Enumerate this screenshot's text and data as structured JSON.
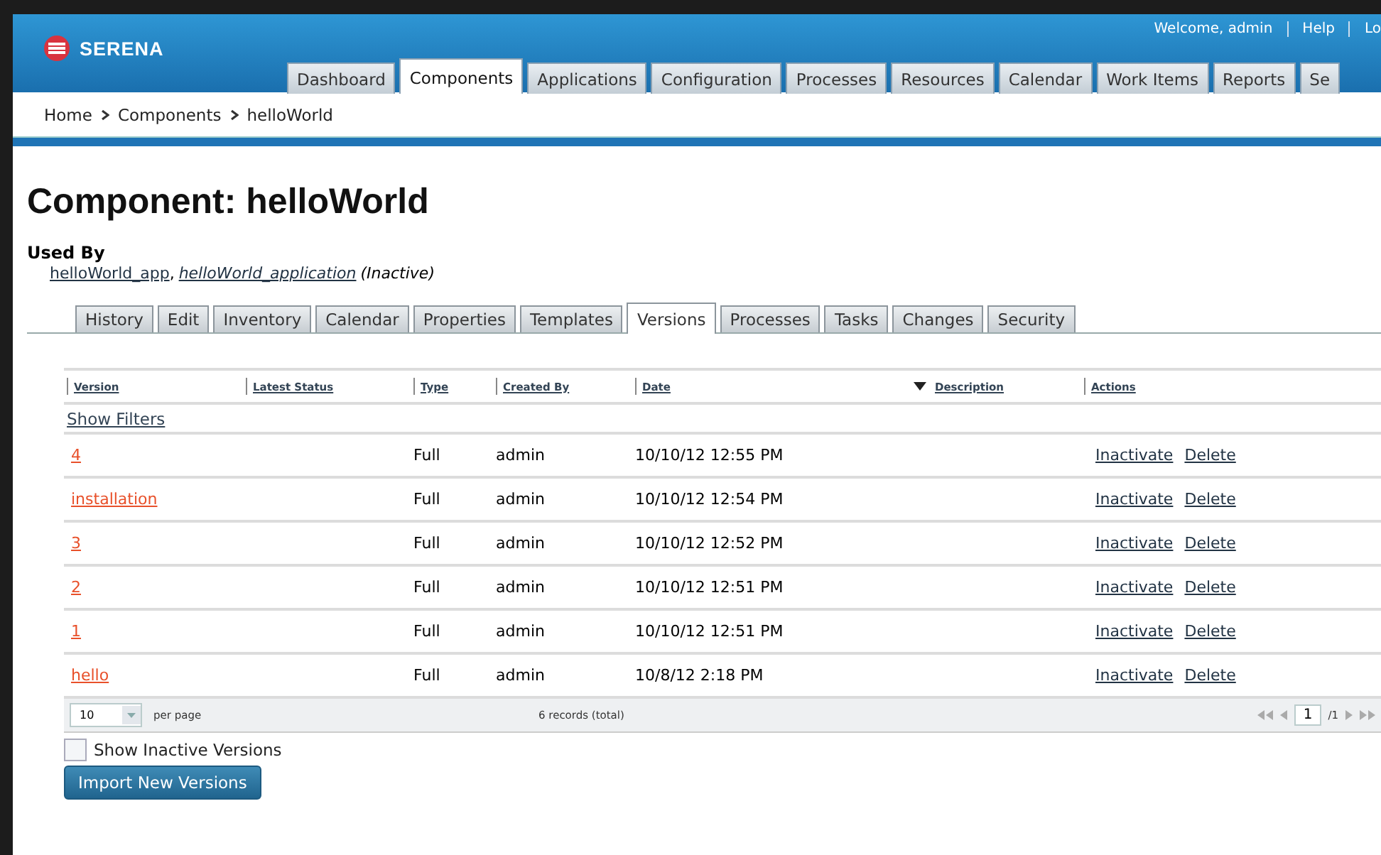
{
  "header": {
    "logo": "SERENA",
    "user_links": [
      {
        "label": "Welcome, admin"
      },
      {
        "label": "Help"
      },
      {
        "label": "Lo"
      }
    ]
  },
  "main_tabs": [
    {
      "label": "Dashboard",
      "selected": false
    },
    {
      "label": "Components",
      "selected": true
    },
    {
      "label": "Applications",
      "selected": false
    },
    {
      "label": "Configuration",
      "selected": false
    },
    {
      "label": "Processes",
      "selected": false
    },
    {
      "label": "Resources",
      "selected": false
    },
    {
      "label": "Calendar",
      "selected": false
    },
    {
      "label": "Work Items",
      "selected": false
    },
    {
      "label": "Reports",
      "selected": false
    },
    {
      "label": "Se",
      "selected": false
    }
  ],
  "breadcrumb": [
    "Home",
    "Components",
    "helloWorld"
  ],
  "title": "Component: helloWorld",
  "used_by": {
    "label": "Used By",
    "links": [
      "helloWorld_app",
      "helloWorld_application"
    ],
    "separator": ",",
    "note": "(Inactive)"
  },
  "sub_tabs": [
    {
      "label": "History",
      "selected": false
    },
    {
      "label": "Edit",
      "selected": false
    },
    {
      "label": "Inventory",
      "selected": false
    },
    {
      "label": "Calendar",
      "selected": false
    },
    {
      "label": "Properties",
      "selected": false
    },
    {
      "label": "Templates",
      "selected": false
    },
    {
      "label": "Versions",
      "selected": true
    },
    {
      "label": "Processes",
      "selected": false
    },
    {
      "label": "Tasks",
      "selected": false
    },
    {
      "label": "Changes",
      "selected": false
    },
    {
      "label": "Security",
      "selected": false
    }
  ],
  "table": {
    "columns": [
      {
        "label": "Version",
        "sorted": false
      },
      {
        "label": "Latest Status",
        "sorted": false
      },
      {
        "label": "Type",
        "sorted": false
      },
      {
        "label": "Created By",
        "sorted": false
      },
      {
        "label": "Date",
        "sorted": false
      },
      {
        "label": "Description",
        "sorted": true
      },
      {
        "label": "Actions",
        "sorted": false
      }
    ],
    "filter_link": "Show Filters",
    "rows": [
      {
        "version": "4",
        "type": "Full",
        "created_by": "admin",
        "date": "10/10/12 12:55 PM",
        "actions": [
          "Inactivate",
          "Delete"
        ]
      },
      {
        "version": "installation",
        "type": "Full",
        "created_by": "admin",
        "date": "10/10/12 12:54 PM",
        "actions": [
          "Inactivate",
          "Delete"
        ]
      },
      {
        "version": "3",
        "type": "Full",
        "created_by": "admin",
        "date": "10/10/12 12:52 PM",
        "actions": [
          "Inactivate",
          "Delete"
        ]
      },
      {
        "version": "2",
        "type": "Full",
        "created_by": "admin",
        "date": "10/10/12 12:51 PM",
        "actions": [
          "Inactivate",
          "Delete"
        ]
      },
      {
        "version": "1",
        "type": "Full",
        "created_by": "admin",
        "date": "10/10/12 12:51 PM",
        "actions": [
          "Inactivate",
          "Delete"
        ]
      },
      {
        "version": "hello",
        "type": "Full",
        "created_by": "admin",
        "date": "10/8/12 2:18 PM",
        "actions": [
          "Inactivate",
          "Delete"
        ]
      }
    ],
    "pager": {
      "page_size": "10",
      "per_page": "per page",
      "records": "6 records (total)",
      "page": "1",
      "of": "/1"
    }
  },
  "show_inactive": {
    "label": "Show Inactive Versions",
    "checked": false
  },
  "import_button": "Import New Versions"
}
